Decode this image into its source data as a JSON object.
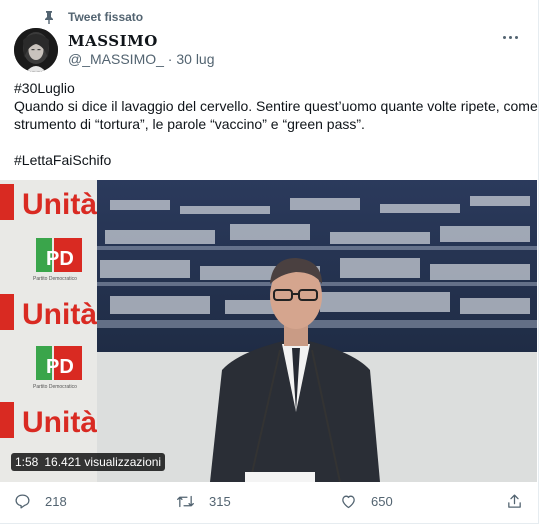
{
  "pinned": {
    "label": "Tweet fissato"
  },
  "author": {
    "name": "MASSIMO",
    "handle": "@_MASSIMO_",
    "separator": "·",
    "date": "30 lug"
  },
  "body": {
    "hashtag1": "#30Luglio",
    "line1": "Quando si dice il lavaggio del cervello. Sentire quest’uomo quante volte ripete, come",
    "line2": "strumento di “tortura”, le parole  “vaccino” e “green pass”.",
    "hashtag2": "#LettaFaiSchifo"
  },
  "video": {
    "duration": "1:58",
    "views": "16.421 visualizzazioni",
    "banner_text": "Unità",
    "logo_initials": "PD",
    "logo_caption": "Partito Democratico"
  },
  "actions": {
    "replies": "218",
    "retweets": "315",
    "likes": "650"
  },
  "colors": {
    "accent": "#1d9bf0",
    "muted": "#536471",
    "text": "#0f1419",
    "unita_red": "#d92a22",
    "pd_green": "#3aa54b"
  },
  "icons": [
    "pin-icon",
    "more-icon",
    "reply-icon",
    "retweet-icon",
    "like-icon",
    "share-icon"
  ]
}
